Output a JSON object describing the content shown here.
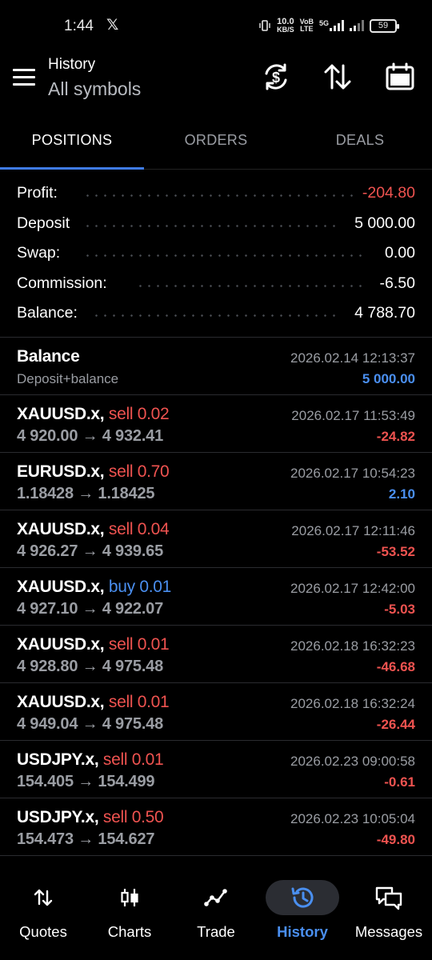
{
  "status": {
    "time": "1:44",
    "x_logo": "𝕏",
    "net_speed_top": "10.0",
    "net_speed_bottom": "KB/S",
    "volte_top": "VoB",
    "volte_bottom": "LTE",
    "fiveg": "5G",
    "battery": "59"
  },
  "header": {
    "title": "History",
    "subtitle": "All symbols"
  },
  "tabs": [
    {
      "label": "POSITIONS",
      "active": true
    },
    {
      "label": "ORDERS",
      "active": false
    },
    {
      "label": "DEALS",
      "active": false
    }
  ],
  "summary": [
    {
      "label": "Profit:",
      "value": "-204.80",
      "negative": true
    },
    {
      "label": "Deposit",
      "value": "5 000.00",
      "negative": false
    },
    {
      "label": "Swap:",
      "value": "0.00",
      "negative": false
    },
    {
      "label": "Commission:",
      "value": "-6.50",
      "negative": false
    },
    {
      "label": "Balance:",
      "value": "4 788.70",
      "negative": false
    }
  ],
  "balance_entry": {
    "title": "Balance",
    "subtitle": "Deposit+balance",
    "date": "2026.02.14 12:13:37",
    "amount": "5 000.00"
  },
  "deals": [
    {
      "symbol": "XAUUSD.x,",
      "side": "sell 0.02",
      "type": "sell",
      "prices": "4 920.00 → 4 932.41",
      "date": "2026.02.17 11:53:49",
      "profit": "-24.82"
    },
    {
      "symbol": "EURUSD.x,",
      "side": "sell 0.70",
      "type": "sell",
      "prices": "1.18428 → 1.18425",
      "date": "2026.02.17 10:54:23",
      "profit": "2.10"
    },
    {
      "symbol": "XAUUSD.x,",
      "side": "sell 0.04",
      "type": "sell",
      "prices": "4 926.27 → 4 939.65",
      "date": "2026.02.17 12:11:46",
      "profit": "-53.52"
    },
    {
      "symbol": "XAUUSD.x,",
      "side": "buy 0.01",
      "type": "buy",
      "prices": "4 927.10 → 4 922.07",
      "date": "2026.02.17 12:42:00",
      "profit": "-5.03"
    },
    {
      "symbol": "XAUUSD.x,",
      "side": "sell 0.01",
      "type": "sell",
      "prices": "4 928.80 → 4 975.48",
      "date": "2026.02.18 16:32:23",
      "profit": "-46.68"
    },
    {
      "symbol": "XAUUSD.x,",
      "side": "sell 0.01",
      "type": "sell",
      "prices": "4 949.04 → 4 975.48",
      "date": "2026.02.18 16:32:24",
      "profit": "-26.44"
    },
    {
      "symbol": "USDJPY.x,",
      "side": "sell 0.01",
      "type": "sell",
      "prices": "154.405 → 154.499",
      "date": "2026.02.23 09:00:58",
      "profit": "-0.61"
    },
    {
      "symbol": "USDJPY.x,",
      "side": "sell 0.50",
      "type": "sell",
      "prices": "154.473 → 154.627",
      "date": "2026.02.23 10:05:04",
      "profit": "-49.80"
    }
  ],
  "nav": [
    {
      "label": "Quotes",
      "icon": "quotes-arrows-icon",
      "active": false
    },
    {
      "label": "Charts",
      "icon": "candlestick-icon",
      "active": false
    },
    {
      "label": "Trade",
      "icon": "trade-line-icon",
      "active": false
    },
    {
      "label": "History",
      "icon": "history-clock-icon",
      "active": true
    },
    {
      "label": "Messages",
      "icon": "messages-icon",
      "active": false
    }
  ],
  "colors": {
    "accent": "#3f7be6",
    "loss": "#ef5350",
    "gain": "#4a8ff0"
  }
}
